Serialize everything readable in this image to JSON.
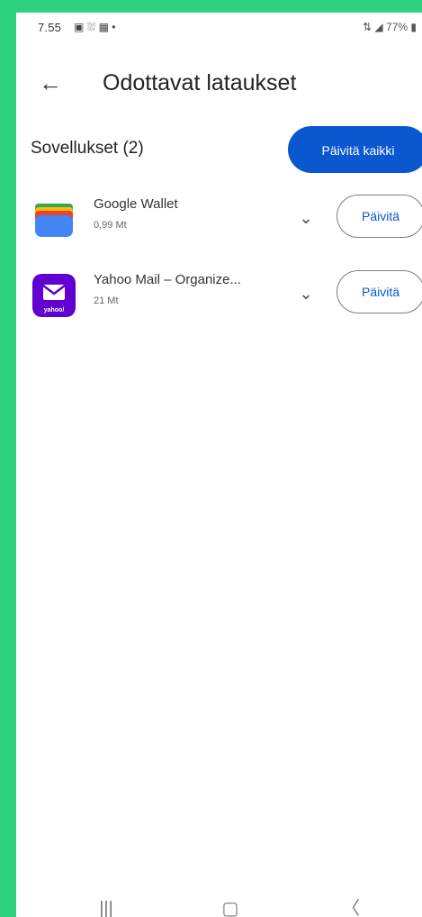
{
  "status_bar": {
    "time": "7.55",
    "battery": "77%",
    "left_icons": "▣ ⛆ ▦ •",
    "right_icons": "⇅ ◢"
  },
  "app_bar": {
    "back_icon": "←",
    "title": "Odottavat lataukset"
  },
  "section": {
    "title": "Sovellukset (2)",
    "update_all_label": "Päivitä kaikki"
  },
  "apps": [
    {
      "name": "Google Wallet",
      "size": "0,99 Mt",
      "update_label": "Päivitä",
      "chevron": "⌄"
    },
    {
      "name": "Yahoo Mail – Organize...",
      "size": "21 Mt",
      "update_label": "Päivitä",
      "chevron": "⌄",
      "icon_text": "yahoo/"
    }
  ],
  "navbar": {
    "recent_icon": "|||",
    "home_icon": "▢",
    "back_icon": "〈"
  },
  "colors": {
    "accent": "#0b57d0",
    "background": "#2ed27e"
  }
}
